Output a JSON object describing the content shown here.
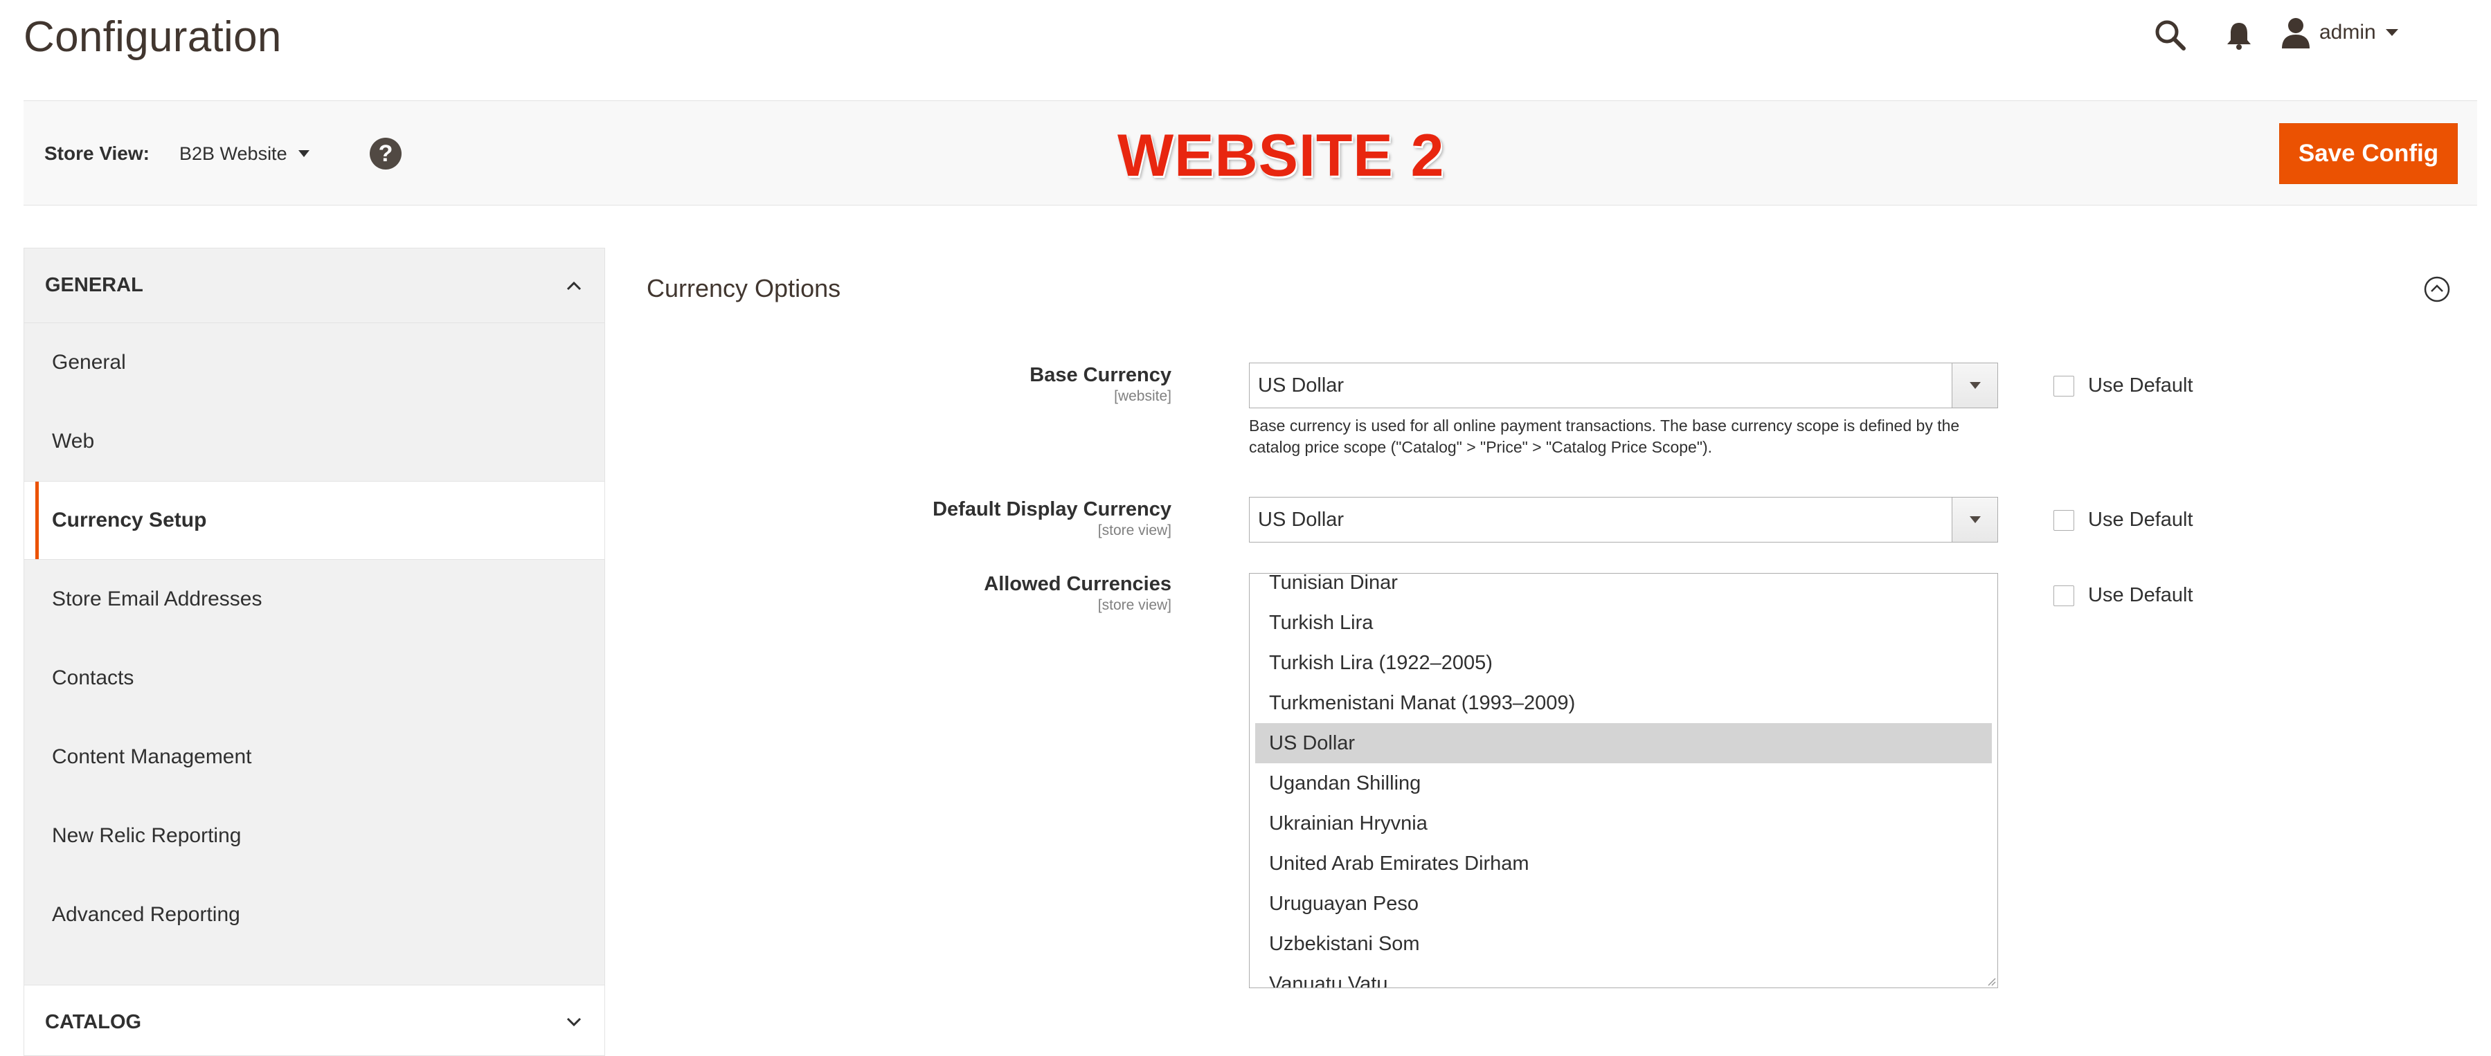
{
  "page": {
    "title": "Configuration"
  },
  "header": {
    "user_name": "admin"
  },
  "store_bar": {
    "label": "Store View:",
    "selected": "B2B Website",
    "help": "?",
    "badge": "WEBSITE 2",
    "save_label": "Save Config"
  },
  "sidebar": {
    "general_title": "GENERAL",
    "items": [
      {
        "label": "General"
      },
      {
        "label": "Web"
      },
      {
        "label": "Currency Setup"
      },
      {
        "label": "Store Email Addresses"
      },
      {
        "label": "Contacts"
      },
      {
        "label": "Content Management"
      },
      {
        "label": "New Relic Reporting"
      },
      {
        "label": "Advanced Reporting"
      }
    ],
    "active_item": "Currency Setup",
    "catalog_title": "CATALOG"
  },
  "currency_options": {
    "title": "Currency Options",
    "base": {
      "label": "Base Currency",
      "scope": "[website]",
      "value": "US Dollar",
      "note": "Base currency is used for all online payment transactions. The base currency scope is defined by the catalog price scope (\"Catalog\" > \"Price\" > \"Catalog Price Scope\").",
      "use_default": "Use Default"
    },
    "display": {
      "label": "Default Display Currency",
      "scope": "[store view]",
      "value": "US Dollar",
      "use_default": "Use Default"
    },
    "allowed": {
      "label": "Allowed Currencies",
      "scope": "[store view]",
      "options": [
        "Tunisian Dinar",
        "Turkish Lira",
        "Turkish Lira (1922–2005)",
        "Turkmenistani Manat (1993–2009)",
        "US Dollar",
        "Ugandan Shilling",
        "Ukrainian Hryvnia",
        "United Arab Emirates Dirham",
        "Uruguayan Peso",
        "Uzbekistani Som",
        "Vanuatu Vatu"
      ],
      "selected": "US Dollar",
      "use_default": "Use Default"
    }
  },
  "colors": {
    "accent": "#eb5202",
    "badge_red": "#e8260f",
    "sidebar_bg": "#f1f1f1",
    "selected_bg": "#d4d4d4"
  },
  "icons": [
    "search-icon",
    "bell-icon",
    "user-icon",
    "help-icon",
    "chevron-up-icon",
    "chevron-down-icon",
    "collapse-circle-icon"
  ]
}
